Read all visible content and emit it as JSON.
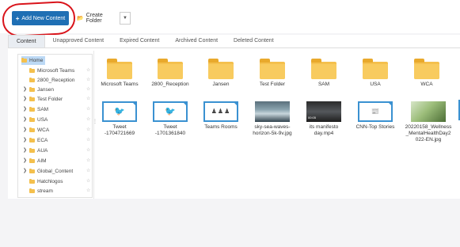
{
  "toolbar": {
    "add_label": "Add New Content",
    "create_folder_label": "Create Folder"
  },
  "tabs": [
    {
      "label": "Content",
      "active": true
    },
    {
      "label": "Unapproved Content"
    },
    {
      "label": "Expired Content"
    },
    {
      "label": "Archived Content"
    },
    {
      "label": "Deleted Content"
    }
  ],
  "tree": {
    "root": "Home",
    "items": [
      {
        "label": "Microsoft Teams",
        "expandable": false
      },
      {
        "label": "2800_Reception",
        "expandable": false
      },
      {
        "label": "Jansen",
        "expandable": true
      },
      {
        "label": "Test Folder",
        "expandable": true
      },
      {
        "label": "SAM",
        "expandable": true
      },
      {
        "label": "USA",
        "expandable": true
      },
      {
        "label": "WCA",
        "expandable": true
      },
      {
        "label": "ECA",
        "expandable": true
      },
      {
        "label": "AUA",
        "expandable": true
      },
      {
        "label": "AIM",
        "expandable": true
      },
      {
        "label": "Global_Content",
        "expandable": true
      },
      {
        "label": "Hatchlogos",
        "expandable": false
      },
      {
        "label": "stream",
        "expandable": false
      }
    ]
  },
  "grid": {
    "folders": [
      "Microsoft Teams",
      "2800_Reception",
      "Jansen",
      "Test Folder",
      "SAM",
      "USA",
      "WCA"
    ],
    "files": [
      {
        "label": "Tweet -1704721669",
        "kind": "twitter"
      },
      {
        "label": "Tweet -1701361840",
        "kind": "twitter"
      },
      {
        "label": "Teams Rooms",
        "kind": "people"
      },
      {
        "label": "sky-sea-waves-horizon-5k-9v.jpg",
        "kind": "image-sea"
      },
      {
        "label": "its manifesto day.mp4",
        "kind": "video",
        "timestamp": "00:05"
      },
      {
        "label": "CNN-Top Stories",
        "kind": "news"
      },
      {
        "label": "20220158_Wellness_MentalHealthDay2022-EN.jpg",
        "kind": "image-green"
      }
    ]
  },
  "colors": {
    "primary": "#1f6fb4",
    "annotation": "#d9141b",
    "folder": "#f4c04d",
    "selected": "#bcd9f5"
  }
}
